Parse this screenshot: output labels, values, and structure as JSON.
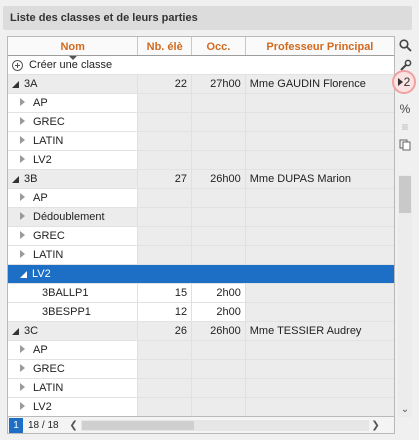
{
  "panel": {
    "title": "Liste des classes et de leurs parties"
  },
  "columns": {
    "nom": "Nom",
    "nb": "Nb. élè",
    "occ": "Occ.",
    "prof": "Professeur Principal"
  },
  "create_label": "Créer une classe",
  "rows": [
    {
      "type": "class",
      "nom": "3A",
      "nb": "22",
      "occ": "27h00",
      "prof": "Mme GAUDIN Florence"
    },
    {
      "type": "part",
      "nom": "AP"
    },
    {
      "type": "part",
      "nom": "GREC"
    },
    {
      "type": "part",
      "nom": "LATIN"
    },
    {
      "type": "part",
      "nom": "LV2"
    },
    {
      "type": "class",
      "nom": "3B",
      "nb": "27",
      "occ": "26h00",
      "prof": "Mme DUPAS Marion"
    },
    {
      "type": "part",
      "nom": "AP"
    },
    {
      "type": "group",
      "nom": "Dédoublement"
    },
    {
      "type": "part",
      "nom": "GREC"
    },
    {
      "type": "part",
      "nom": "LATIN"
    },
    {
      "type": "selected",
      "nom": "LV2"
    },
    {
      "type": "sub",
      "nom": "3BALLP1",
      "nb": "15",
      "occ": "2h00"
    },
    {
      "type": "sub",
      "nom": "3BESPP1",
      "nb": "12",
      "occ": "2h00"
    },
    {
      "type": "class",
      "nom": "3C",
      "nb": "26",
      "occ": "26h00",
      "prof": "Mme TESSIER Audrey"
    },
    {
      "type": "part",
      "nom": "AP"
    },
    {
      "type": "part",
      "nom": "GREC"
    },
    {
      "type": "part",
      "nom": "LATIN"
    },
    {
      "type": "part",
      "nom": "LV2"
    }
  ],
  "footer": {
    "page": "1",
    "count": "18 / 18"
  },
  "toolbar": {
    "badge_value": "2",
    "percent": "%"
  }
}
